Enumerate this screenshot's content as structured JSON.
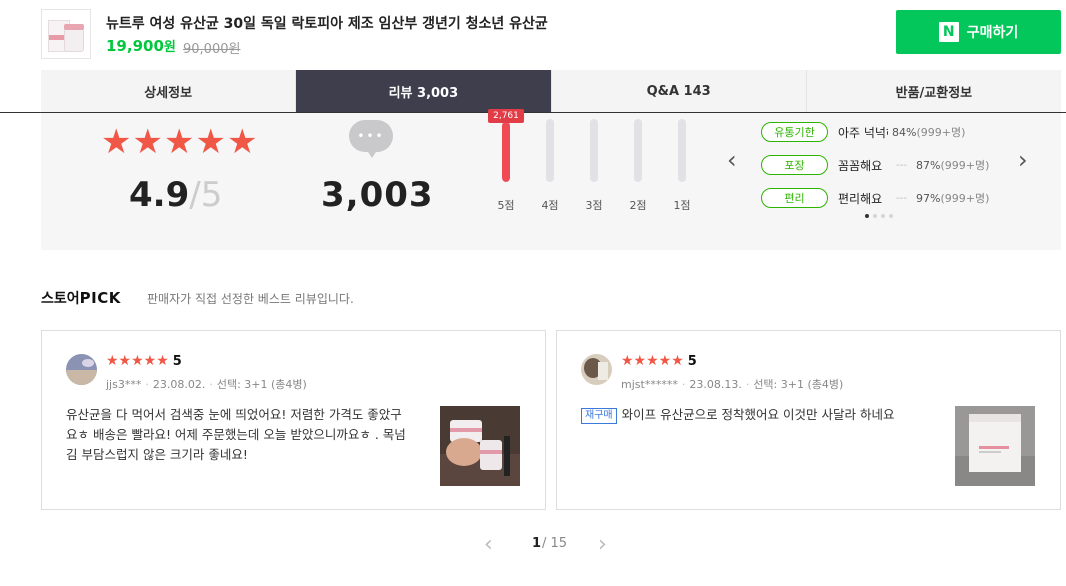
{
  "product": {
    "title": "뉴트루 여성 유산균 30일 독일 락토피아 제조 임산부 갱년기 청소년 유산균",
    "price": "19,900",
    "price_unit": "원",
    "original_price": "90,000원",
    "buy_logo": "N",
    "buy_label": "구매하기"
  },
  "tabs": [
    {
      "label": "상세정보",
      "active": false
    },
    {
      "label": "리뷰 3,003",
      "active": true
    },
    {
      "label": "Q&A 143",
      "active": false
    },
    {
      "label": "반품/교환정보",
      "active": false
    }
  ],
  "summary": {
    "rating": "4.9",
    "rating_max": "/5",
    "review_count": "3,003",
    "rating_bars": [
      {
        "label": "5점",
        "fraction": 0.96,
        "tip": "2,761"
      },
      {
        "label": "4점",
        "fraction": 0.0
      },
      {
        "label": "3점",
        "fraction": 0.0
      },
      {
        "label": "2점",
        "fraction": 0.0
      },
      {
        "label": "1점",
        "fraction": 0.0
      }
    ],
    "attributes": [
      {
        "tag": "유통기한",
        "value": "아주 넉넉해요",
        "dash": "",
        "pct": "84%",
        "count": "(999+명)"
      },
      {
        "tag": "포장",
        "value": "꼼꼼해요",
        "dash": "---",
        "pct": "87%",
        "count": "(999+명)"
      },
      {
        "tag": "편리",
        "value": "편리해요",
        "dash": "---",
        "pct": "97%",
        "count": "(999+명)"
      }
    ],
    "prev_icon": "chevron-left",
    "next_icon": "chevron-right"
  },
  "store_pick": {
    "title": "스토어",
    "title_pick": "PICK",
    "subtitle": "판매자가 직접 선정한 베스트 리뷰입니다."
  },
  "reviews": [
    {
      "score": "5",
      "user": "jjs3***",
      "date": "23.08.02.",
      "option": "선택: 3+1 (총4병)",
      "rebuy": "",
      "text": "유산균을 다 먹어서 검색중 눈에 띄었어요! 저렴한 가격도 좋았구요ㅎ 배송은 빨라요! 어제 주문했는데 오늘 받았으니까요ㅎ . 목넘김 부담스럽지 않은 크기라 좋네요!"
    },
    {
      "score": "5",
      "user": "mjst******",
      "date": "23.08.13.",
      "option": "선택: 3+1 (총4병)",
      "rebuy": "재구매",
      "text": "와이프 유산균으로 정착했어요 이것만 사달라 하네요"
    }
  ],
  "pager": {
    "current": "1",
    "total": "/ 15"
  },
  "colors": {
    "accent_green": "#03c75a",
    "star_red": "#f15746",
    "tab_active": "#3e3e4d"
  }
}
